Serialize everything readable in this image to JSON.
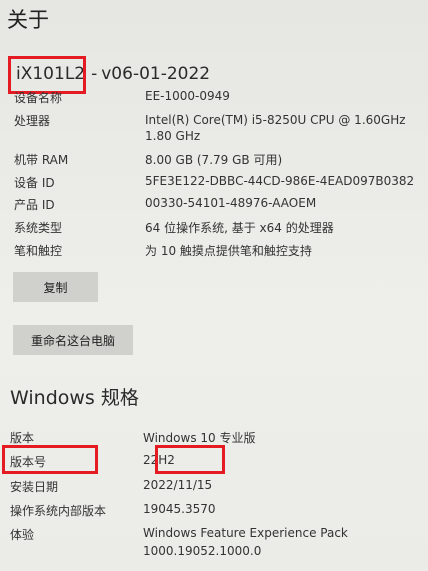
{
  "page_title": "关于",
  "device": {
    "name": "iX101L2",
    "separator": "-",
    "version": "v06-01-2022"
  },
  "device_specs": [
    {
      "label": "设备名称",
      "value": "EE-1000-0949"
    },
    {
      "label": "处理器",
      "value": "Intel(R) Core(TM) i5-8250U CPU @ 1.60GHz   1.80 GHz"
    },
    {
      "label": "机带 RAM",
      "value": "8.00 GB (7.79 GB 可用)"
    },
    {
      "label": "设备 ID",
      "value": "5FE3E122-DBBC-44CD-986E-4EAD097B0382"
    },
    {
      "label": "产品 ID",
      "value": "00330-54101-48976-AAOEM"
    },
    {
      "label": "系统类型",
      "value": "64 位操作系统, 基于 x64 的处理器"
    },
    {
      "label": "笔和触控",
      "value": "为 10 触摸点提供笔和触控支持"
    }
  ],
  "buttons": {
    "copy": "复制",
    "rename": "重命名这台电脑"
  },
  "windows_specs": {
    "title": "Windows 规格",
    "rows": [
      {
        "label": "版本",
        "value": "Windows 10 专业版"
      },
      {
        "label": "版本号",
        "value": "22H2"
      },
      {
        "label": "安装日期",
        "value": "2022/11/15"
      },
      {
        "label": "操作系统内部版本",
        "value": "19045.3570"
      },
      {
        "label": "体验",
        "value": "Windows Feature Experience Pack 1000.19052.1000.0"
      }
    ]
  },
  "colors": {
    "highlight": "#e51b23",
    "background": "#e9e9e5",
    "button": "#d0d0cc"
  }
}
